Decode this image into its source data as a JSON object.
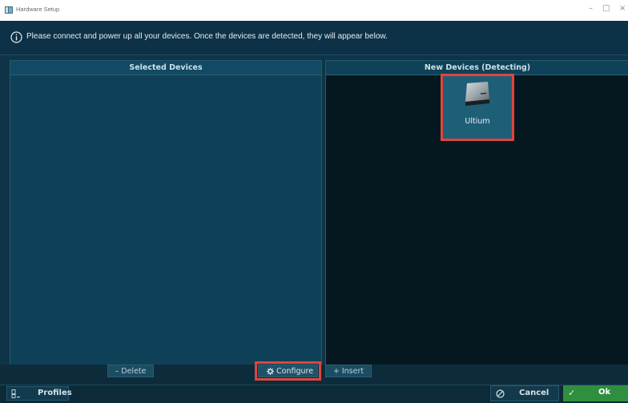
{
  "window": {
    "title": "Hardware Setup",
    "minimize": "–",
    "maximize": "□",
    "close": "×"
  },
  "info": {
    "icon": "info-icon",
    "text": "Please connect and power up all your devices. Once the devices are detected, they will appear below."
  },
  "selected_panel": {
    "header": "Selected Devices",
    "items": []
  },
  "new_panel": {
    "header": "New Devices (Detecting)",
    "devices": [
      {
        "label": "Ultium",
        "icon": "device-icon"
      }
    ]
  },
  "actions": {
    "delete_label": "– Delete",
    "configure_label": "Configure",
    "configure_icon": "gear-icon",
    "insert_label": "+ Insert"
  },
  "footer": {
    "profiles_label": "Profiles",
    "profiles_icon": "profiles-icon",
    "cancel_label": "Cancel",
    "cancel_icon": "cancel-icon",
    "ok_label": "Ok",
    "ok_icon": "check-icon"
  },
  "colors": {
    "background": "#0f3448",
    "panel": "#0e4058",
    "detect_panel": "#06181f",
    "highlight": "#e0453a",
    "ok_green": "#2f8f3e"
  }
}
